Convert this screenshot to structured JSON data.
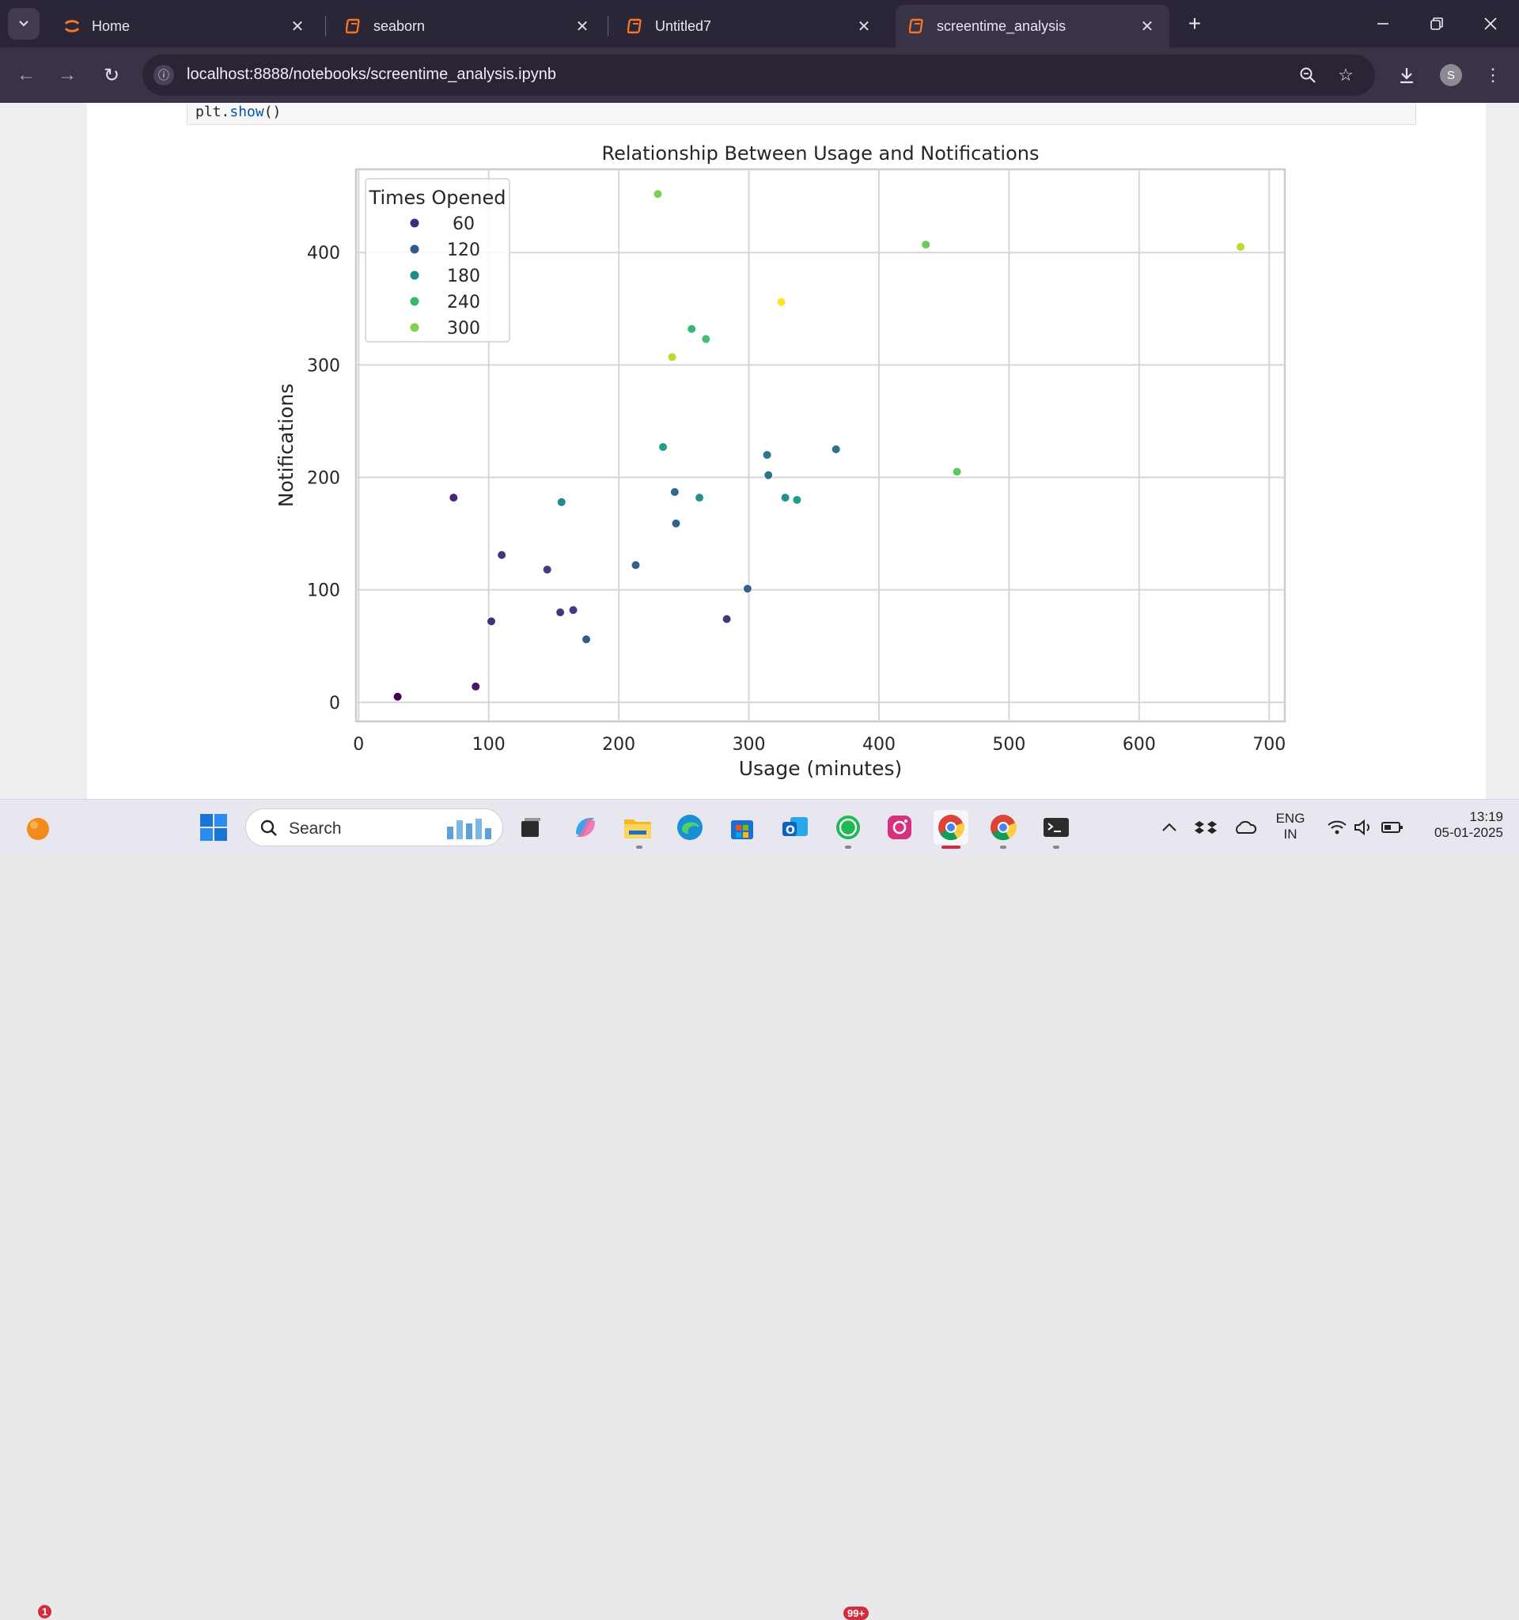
{
  "browser": {
    "tabs": [
      {
        "title": "Home",
        "icon": "jupyter-icon",
        "active": false
      },
      {
        "title": "seaborn",
        "icon": "notebook-icon",
        "active": false
      },
      {
        "title": "Untitled7",
        "icon": "notebook-icon",
        "active": false
      },
      {
        "title": "screentime_analysis",
        "icon": "notebook-icon",
        "active": true
      }
    ],
    "url": "localhost:8888/notebooks/screentime_analysis.ipynb",
    "profile_initial": "S"
  },
  "notebook": {
    "code_prefix": "plt.",
    "code_fn": "show",
    "code_suffix": "()"
  },
  "chart_data": {
    "type": "scatter",
    "title": "Relationship Between Usage and Notifications",
    "xlabel": "Usage (minutes)",
    "ylabel": "Notifications",
    "xlim": [
      -2,
      712
    ],
    "ylim": [
      -17,
      474
    ],
    "xticks": [
      0,
      100,
      200,
      300,
      400,
      500,
      600,
      700
    ],
    "yticks": [
      0,
      100,
      200,
      300,
      400
    ],
    "grid": true,
    "legend": {
      "title": "Times Opened",
      "placement": "top-left",
      "entries": [
        {
          "label": "60",
          "color": "#3b2f7d"
        },
        {
          "label": "120",
          "color": "#30598c"
        },
        {
          "label": "180",
          "color": "#218b8b"
        },
        {
          "label": "240",
          "color": "#3ab86a"
        },
        {
          "label": "300",
          "color": "#7ed34f"
        }
      ]
    },
    "colormap": "viridis",
    "hue_range": [
      10,
      330
    ],
    "points": [
      {
        "x": 30,
        "y": 5,
        "hue": 10
      },
      {
        "x": 90,
        "y": 14,
        "hue": 30
      },
      {
        "x": 73,
        "y": 182,
        "hue": 45
      },
      {
        "x": 102,
        "y": 72,
        "hue": 55
      },
      {
        "x": 110,
        "y": 131,
        "hue": 60
      },
      {
        "x": 145,
        "y": 118,
        "hue": 65
      },
      {
        "x": 155,
        "y": 80,
        "hue": 60
      },
      {
        "x": 165,
        "y": 82,
        "hue": 65
      },
      {
        "x": 283,
        "y": 74,
        "hue": 60
      },
      {
        "x": 175,
        "y": 56,
        "hue": 100
      },
      {
        "x": 213,
        "y": 122,
        "hue": 105
      },
      {
        "x": 244,
        "y": 159,
        "hue": 110
      },
      {
        "x": 299,
        "y": 101,
        "hue": 110
      },
      {
        "x": 243,
        "y": 187,
        "hue": 115
      },
      {
        "x": 315,
        "y": 202,
        "hue": 130
      },
      {
        "x": 367,
        "y": 225,
        "hue": 130
      },
      {
        "x": 314,
        "y": 220,
        "hue": 135
      },
      {
        "x": 156,
        "y": 178,
        "hue": 160
      },
      {
        "x": 262,
        "y": 182,
        "hue": 170
      },
      {
        "x": 328,
        "y": 182,
        "hue": 170
      },
      {
        "x": 337,
        "y": 180,
        "hue": 185
      },
      {
        "x": 234,
        "y": 227,
        "hue": 190
      },
      {
        "x": 256,
        "y": 332,
        "hue": 225
      },
      {
        "x": 267,
        "y": 323,
        "hue": 235
      },
      {
        "x": 460,
        "y": 205,
        "hue": 250
      },
      {
        "x": 436,
        "y": 407,
        "hue": 255
      },
      {
        "x": 230,
        "y": 452,
        "hue": 265
      },
      {
        "x": 241,
        "y": 307,
        "hue": 295
      },
      {
        "x": 678,
        "y": 405,
        "hue": 295
      },
      {
        "x": 325,
        "y": 356,
        "hue": 330
      }
    ]
  },
  "taskbar": {
    "search_placeholder": "Search",
    "notification_count": "1",
    "whatsapp_badge": "99+",
    "lang_line1": "ENG",
    "lang_line2": "IN",
    "time": "13:19",
    "date": "05-01-2025"
  }
}
